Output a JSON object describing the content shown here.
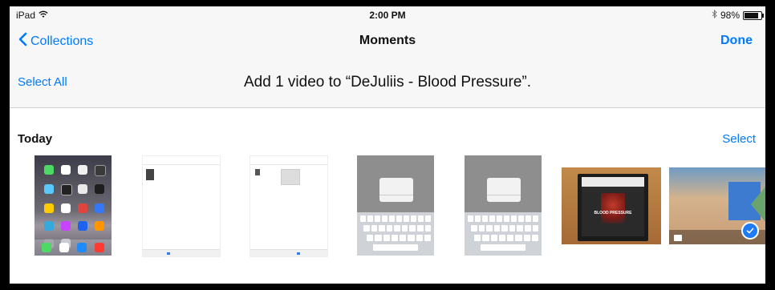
{
  "status_bar": {
    "device": "iPad",
    "time": "2:00 PM",
    "battery": "98%"
  },
  "nav": {
    "back_label": "Collections",
    "title": "Moments",
    "done_label": "Done"
  },
  "toolbar": {
    "select_all_label": "Select All",
    "prompt": "Add 1 video to “DeJuliis - Blood Pressure”."
  },
  "section": {
    "header": "Today",
    "select_label": "Select"
  },
  "thumbnails": [
    {
      "kind": "home-screen"
    },
    {
      "kind": "screenshot"
    },
    {
      "kind": "screenshot"
    },
    {
      "kind": "screenshot-keyboard"
    },
    {
      "kind": "screenshot-keyboard"
    },
    {
      "kind": "photo",
      "overlay_text": "BLOOD PRESSURE"
    },
    {
      "kind": "video",
      "selected": true
    }
  ],
  "colors": {
    "accent": "#007aff",
    "selected_check": "#1c7bf5",
    "scroll_arrow": "#6aa36b"
  },
  "icons": [
    "wifi-icon",
    "bluetooth-icon",
    "battery-icon",
    "chevron-left-icon",
    "checkmark-icon",
    "video-camera-icon"
  ]
}
